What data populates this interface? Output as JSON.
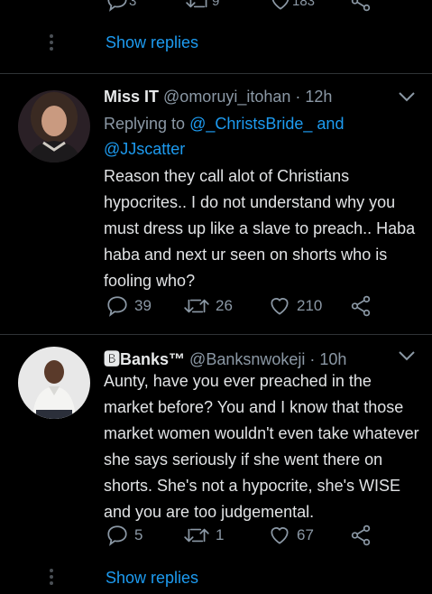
{
  "top_stats": {
    "replies": "3",
    "retweets": "9",
    "likes": "183"
  },
  "show_replies_label": "Show replies",
  "tweets": [
    {
      "name": "Miss IT",
      "handle": "@omoruyi_itohan",
      "time": "12h",
      "replying_prefix": "Replying to",
      "replying_to_1": "@_ChristsBride_",
      "replying_and": "and",
      "replying_to_2": "@JJscatter",
      "text": "Reason they call alot of Christians hypocrites.. I do not understand why you must dress up like a slave to preach.. Haba haba and next ur seen on shorts who is fooling who?",
      "replies": "39",
      "retweets": "26",
      "likes": "210"
    },
    {
      "name": "🅱Banks™",
      "handle": "@Banksnwokeji",
      "time": "10h",
      "text": "Aunty, have you ever preached in the market before? You and I know that those market women wouldn't even take whatever she says seriously if she went there on shorts. She's not a hypocrite, she's WISE and you are too judgemental.",
      "replies": "5",
      "retweets": "1",
      "likes": "67"
    }
  ],
  "colors": {
    "background": "#000000",
    "link": "#1d9bf0",
    "muted": "#8b98a5"
  }
}
